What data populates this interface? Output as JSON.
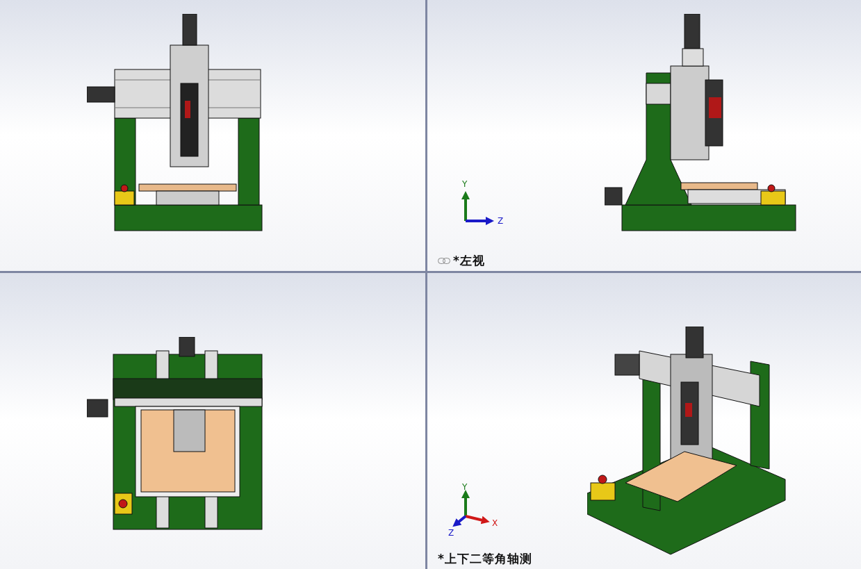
{
  "viewports": [
    {
      "kind": "front"
    },
    {
      "kind": "left",
      "label": "*左视",
      "linked": true,
      "triad": {
        "kind": "side",
        "axes": [
          "Y",
          "Z"
        ]
      }
    },
    {
      "kind": "top"
    },
    {
      "kind": "iso",
      "label": "*上下二等角轴测",
      "linked": false,
      "triad": {
        "kind": "iso",
        "axes": [
          "Y",
          "X",
          "Z"
        ]
      }
    }
  ]
}
